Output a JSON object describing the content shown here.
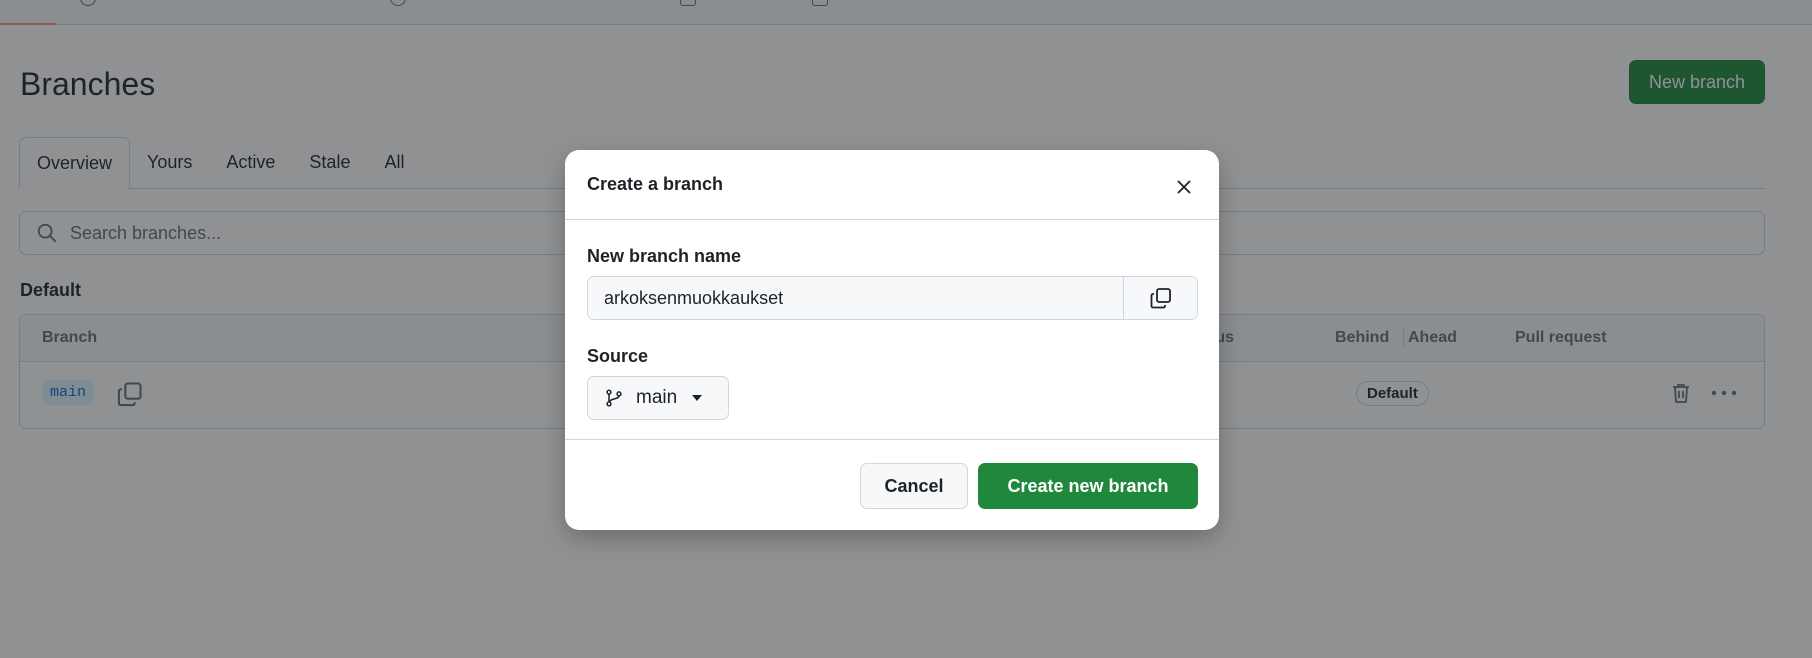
{
  "page": {
    "title": "Branches",
    "new_branch_label": "New branch"
  },
  "tabs": [
    {
      "label": "Overview",
      "active": true
    },
    {
      "label": "Yours"
    },
    {
      "label": "Active"
    },
    {
      "label": "Stale"
    },
    {
      "label": "All"
    }
  ],
  "search": {
    "placeholder": "Search branches..."
  },
  "default_section": {
    "title": "Default",
    "columns": {
      "branch": "Branch",
      "status": "tus",
      "behind": "Behind",
      "ahead": "Ahead",
      "pull_request": "Pull request"
    },
    "rows": [
      {
        "branch": "main",
        "badge": "Default"
      }
    ]
  },
  "dialog": {
    "title": "Create a branch",
    "name_label": "New branch name",
    "name_value": "arkoksenmuokkaukset",
    "source_label": "Source",
    "source_value": "main",
    "cancel_label": "Cancel",
    "create_label": "Create new branch"
  },
  "colors": {
    "primary_green": "#1f883d",
    "overlay": "rgba(31,35,40,0.5)",
    "accent_underline": "#fd8c73"
  },
  "icons": [
    "search-icon",
    "copy-icon",
    "close-icon",
    "git-branch-icon",
    "caret-down-icon",
    "trash-icon",
    "kebab-icon"
  ]
}
